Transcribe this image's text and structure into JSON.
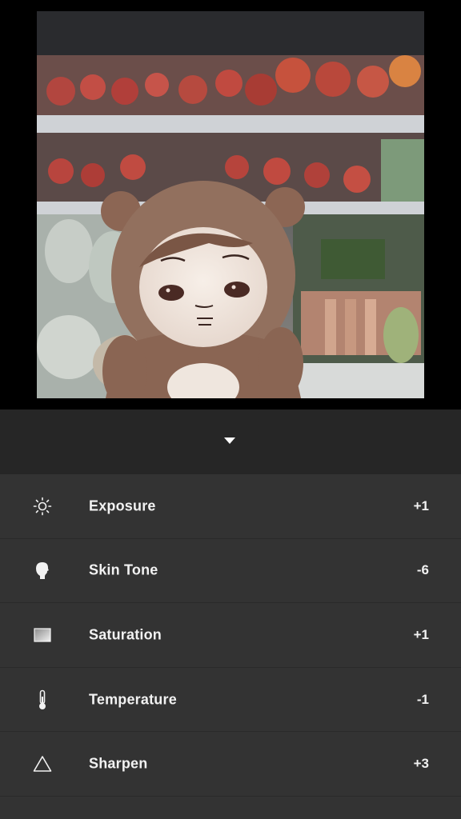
{
  "photo": {
    "subject": "plush-doll-in-supermarket"
  },
  "collapse": {
    "icon": "chevron-down-icon"
  },
  "adjustments": [
    {
      "icon": "sun-icon",
      "label": "Exposure",
      "value": "+1"
    },
    {
      "icon": "face-silhouette-icon",
      "label": "Skin Tone",
      "value": "-6"
    },
    {
      "icon": "gradient-square-icon",
      "label": "Saturation",
      "value": "+1"
    },
    {
      "icon": "thermometer-icon",
      "label": "Temperature",
      "value": "-1"
    },
    {
      "icon": "triangle-icon",
      "label": "Sharpen",
      "value": "+3"
    }
  ],
  "colors": {
    "background": "#000000",
    "collapse_bar": "#262626",
    "list_bg": "#333333",
    "text": "#f2f2f2"
  }
}
